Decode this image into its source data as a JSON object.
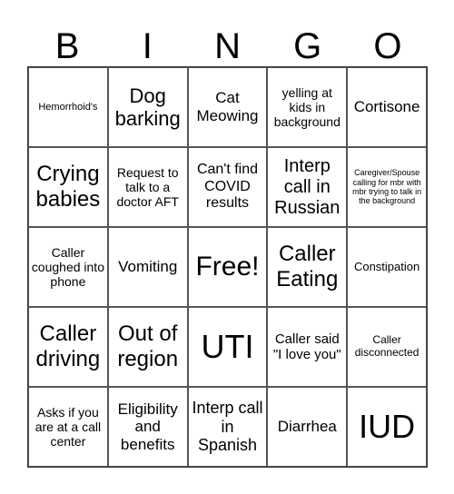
{
  "header": {
    "letters": [
      "B",
      "I",
      "N",
      "G",
      "O"
    ]
  },
  "cells": [
    "Hemorrhoid's",
    "Dog barking",
    "Cat Meowing",
    "yelling at kids in background",
    "Cortisone",
    "Crying babies",
    "Request to talk to a doctor AFT",
    "Can't find COVID results",
    "Interp call in Russian",
    "Caregiver/Spouse calling for mbr with mbr trying to talk in the background",
    "Caller coughed into phone",
    "Vomiting",
    "Free!",
    "Caller Eating",
    "Constipation",
    "Caller driving",
    "Out of region",
    "UTI",
    "Caller said \"I love you\"",
    "Caller disconnected",
    "Asks if you are at a call center",
    "Eligibility and benefits",
    "Interp call in Spanish",
    "Diarrhea",
    "IUD"
  ]
}
